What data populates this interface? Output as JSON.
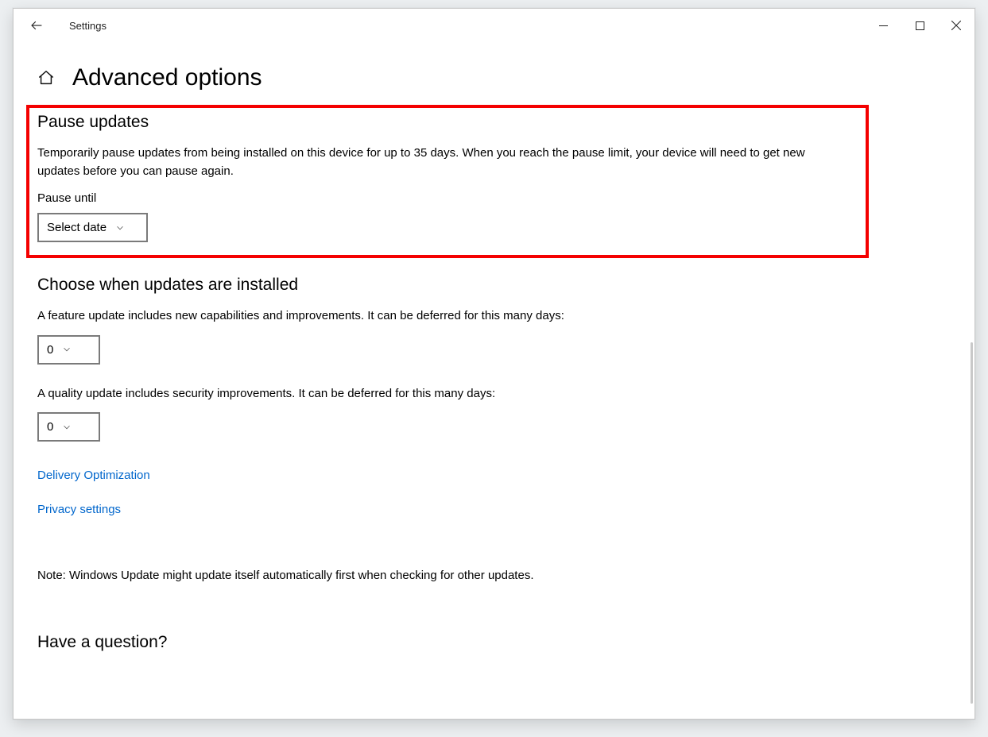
{
  "app_title": "Settings",
  "page_title": "Advanced options",
  "pause": {
    "heading": "Pause updates",
    "description": "Temporarily pause updates from being installed on this device for up to 35 days. When you reach the pause limit, your device will need to get new updates before you can pause again.",
    "label": "Pause until",
    "select_value": "Select date"
  },
  "choose_when": {
    "heading": "Choose when updates are installed",
    "feature_desc": "A feature update includes new capabilities and improvements. It can be deferred for this many days:",
    "feature_value": "0",
    "quality_desc": "A quality update includes security improvements. It can be deferred for this many days:",
    "quality_value": "0"
  },
  "links": {
    "delivery": "Delivery Optimization",
    "privacy": "Privacy settings"
  },
  "note": "Note: Windows Update might update itself automatically first when checking for other updates.",
  "footer_heading": "Have a question?"
}
